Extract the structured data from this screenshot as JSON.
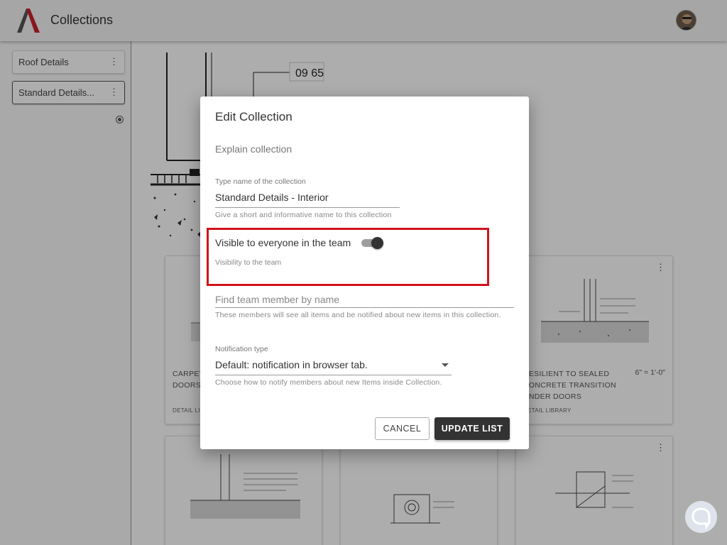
{
  "header": {
    "title": "Collections"
  },
  "sidebar": {
    "items": [
      {
        "label": "Roof Details",
        "menu_icon": "⋮"
      },
      {
        "label": "Standard Details...",
        "menu_icon": "⋮"
      }
    ]
  },
  "main": {
    "preview_label": "09 65",
    "cards": [
      {
        "title": "CARPET TRANSITION DOORS",
        "tag": "DETAIL LIBRARY",
        "menu_icon": "⋮"
      },
      {
        "title": "RESILIENT TO SEALED CONCRETE TRANSITION UNDER DOORS",
        "scale": "6\" = 1'-0\"",
        "tag": "DETAIL LIBRARY",
        "menu_icon": "⋮"
      },
      {
        "menu_icon": "⋮"
      }
    ]
  },
  "dialog": {
    "title": "Edit Collection",
    "explain": "Explain collection",
    "name_field": {
      "label": "Type name of the collection",
      "value": "Standard Details - Interior",
      "hint": "Give a short and informative name to this collection"
    },
    "visibility": {
      "label": "Visible to everyone in the team",
      "hint": "Visibility to the team",
      "enabled": true
    },
    "find_member": {
      "placeholder": "Find team member by name",
      "hint": "These members will see all items and be notified about new items in this collection."
    },
    "notification": {
      "label": "Notification type",
      "value": "Default: notification in browser tab.",
      "hint": "Choose how to notify members about new Items inside Collection."
    },
    "buttons": {
      "cancel": "CANCEL",
      "update": "UPDATE LIST"
    }
  },
  "colors": {
    "highlight": "#d0121b",
    "primary_button": "#333333",
    "logo_red": "#c8232c"
  }
}
